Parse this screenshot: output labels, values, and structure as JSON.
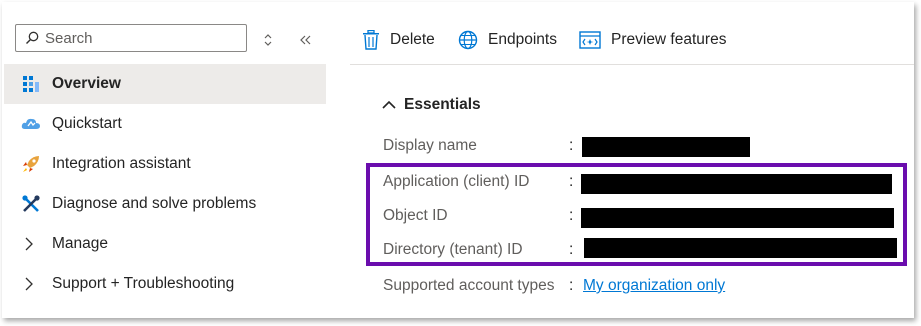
{
  "sidebar": {
    "search": {
      "placeholder": "Search"
    },
    "items": [
      {
        "label": "Overview",
        "icon": "overview-grid-icon",
        "active": true
      },
      {
        "label": "Quickstart",
        "icon": "quickstart-cloud-icon"
      },
      {
        "label": "Integration assistant",
        "icon": "rocket-icon"
      },
      {
        "label": "Diagnose and solve problems",
        "icon": "wrench-icon"
      },
      {
        "label": "Manage",
        "icon": "chevron-right-icon"
      },
      {
        "label": "Support + Troubleshooting",
        "icon": "chevron-right-icon"
      }
    ]
  },
  "toolbar": {
    "delete_label": "Delete",
    "endpoints_label": "Endpoints",
    "preview_label": "Preview features"
  },
  "essentials": {
    "title": "Essentials",
    "properties": [
      {
        "label": "Display name",
        "colon": ":",
        "value_redacted": true
      },
      {
        "label": "Application (client) ID",
        "colon": ":",
        "value_redacted": true
      },
      {
        "label": "Object ID",
        "colon": ":",
        "value_redacted": true
      },
      {
        "label": "Directory (tenant) ID",
        "colon": ":",
        "value_redacted": true
      },
      {
        "label": "Supported account types",
        "colon": ":",
        "value": "My organization only"
      }
    ]
  },
  "colors": {
    "accent": "#0078d4",
    "highlight_border": "#6a0dad",
    "active_bg": "#edebe9",
    "redaction": "#000000"
  }
}
